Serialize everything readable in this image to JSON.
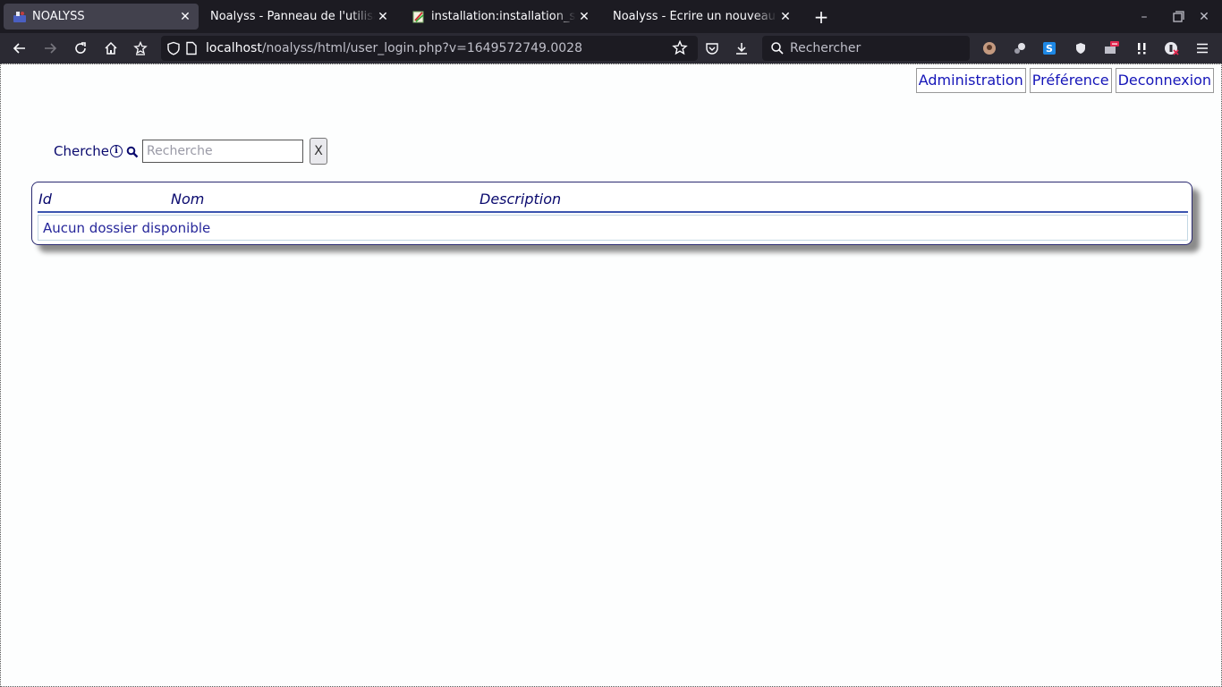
{
  "browser": {
    "tabs": [
      {
        "title": "NOALYSS",
        "active": true
      },
      {
        "title": "Noalyss - Panneau de l'utilisateur",
        "active": false
      },
      {
        "title": "installation:installation_sous_windows",
        "active": false
      },
      {
        "title": "Noalyss - Écrire un nouveau sujet",
        "active": false
      }
    ],
    "url_host": "localhost",
    "url_path": "/noalyss/html/user_login.php?v=1649572749.0028",
    "search_placeholder": "Rechercher"
  },
  "topmenu": {
    "administration": "Administration",
    "preference": "Préférence",
    "deconnexion": "Deconnexion"
  },
  "search": {
    "label": "Cherche",
    "info": "i",
    "placeholder": "Recherche",
    "value": "",
    "clear_label": "X"
  },
  "table": {
    "headers": {
      "id": "Id",
      "nom": "Nom",
      "description": "Description"
    },
    "empty_message": "Aucun dossier disponible"
  },
  "colors": {
    "link": "#1515b8",
    "text_dark_blue": "#0a0a6e",
    "header_rule": "#3c55b0",
    "browser_bg": "#1c1b22"
  }
}
